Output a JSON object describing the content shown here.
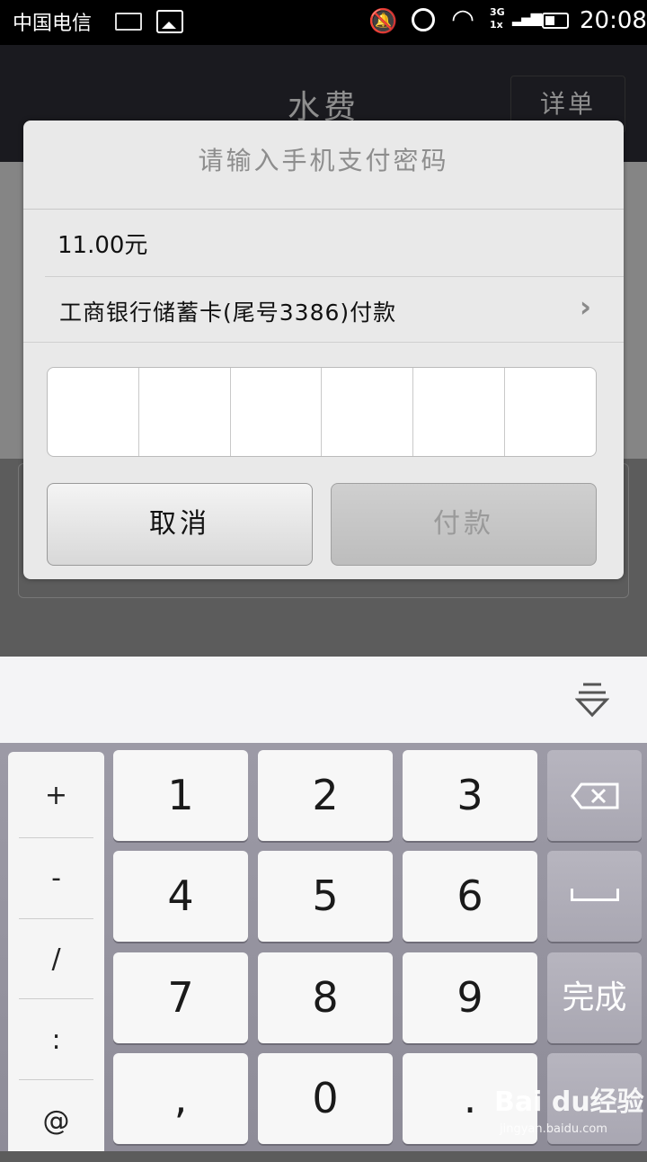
{
  "status": {
    "carrier": "中国电信",
    "network": "3G",
    "network2": "1x",
    "time": "20:08"
  },
  "titlebar": {
    "title": "水费",
    "detail_button": "详单"
  },
  "dialog": {
    "title": "请输入手机支付密码",
    "amount": "11.00元",
    "card_label": "工商银行储蓄卡(尾号3386)付款",
    "cancel_label": "取消",
    "pay_label": "付款",
    "pin_length": 6
  },
  "keyboard": {
    "symbols": [
      "+",
      "-",
      "/",
      ":",
      "@"
    ],
    "digits": [
      "1",
      "2",
      "3",
      "4",
      "5",
      "6",
      "7",
      "8",
      "9",
      ",",
      "0",
      "."
    ],
    "done_label": "完成"
  },
  "watermark": {
    "brand": "Bai du经验",
    "url": "jingyan.baidu.com"
  },
  "icons": {
    "backspace": "backspace-icon",
    "space": "space-icon",
    "hide_keyboard": "hide-keyboard-icon",
    "chevron": "chevron-right-icon"
  }
}
